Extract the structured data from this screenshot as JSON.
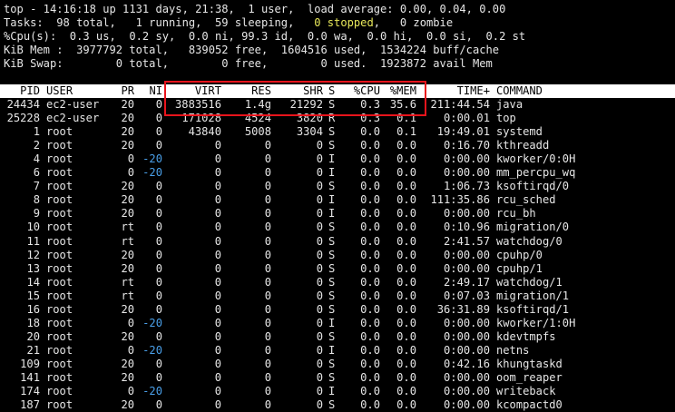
{
  "summary": {
    "line1": "top - 14:16:18 up 1131 days, 21:38,  1 user,  load average: 0.00, 0.04, 0.00",
    "tasks_pre": "Tasks:  98 total,   1 running,  59 sleeping,   ",
    "tasks_stopped": "0 stopped",
    "tasks_post": ",   0 zombie",
    "cpu": "%Cpu(s):  0.3 us,  0.2 sy,  0.0 ni, 99.3 id,  0.0 wa,  0.0 hi,  0.0 si,  0.2 st",
    "mem": "KiB Mem :  3977792 total,   839052 free,  1604516 used,  1534224 buff/cache",
    "swap": "KiB Swap:        0 total,        0 free,        0 used.  1923872 avail Mem"
  },
  "header": {
    "pid": "PID",
    "user": "USER",
    "pr": "PR",
    "ni": "NI",
    "virt": "VIRT",
    "res": "RES",
    "shr": "SHR",
    "s": "S",
    "cpu": "%CPU",
    "mem": "%MEM",
    "time": "TIME+",
    "command": "COMMAND"
  },
  "processes": [
    {
      "pid": "24434",
      "user": "ec2-user",
      "pr": "20",
      "ni": "0",
      "virt": "3883516",
      "res": "1.4g",
      "shr": "21292",
      "s": "S",
      "cpu": "0.3",
      "mem": "35.6",
      "time": "211:44.54",
      "command": "java"
    },
    {
      "pid": "25228",
      "user": "ec2-user",
      "pr": "20",
      "ni": "0",
      "virt": "171028",
      "res": "4524",
      "shr": "3820",
      "s": "R",
      "cpu": "0.3",
      "mem": "0.1",
      "time": "0:00.01",
      "command": "top"
    },
    {
      "pid": "1",
      "user": "root",
      "pr": "20",
      "ni": "0",
      "virt": "43840",
      "res": "5008",
      "shr": "3304",
      "s": "S",
      "cpu": "0.0",
      "mem": "0.1",
      "time": "19:49.01",
      "command": "systemd"
    },
    {
      "pid": "2",
      "user": "root",
      "pr": "20",
      "ni": "0",
      "virt": "0",
      "res": "0",
      "shr": "0",
      "s": "S",
      "cpu": "0.0",
      "mem": "0.0",
      "time": "0:16.70",
      "command": "kthreadd"
    },
    {
      "pid": "4",
      "user": "root",
      "pr": "0",
      "ni": "-20",
      "virt": "0",
      "res": "0",
      "shr": "0",
      "s": "I",
      "cpu": "0.0",
      "mem": "0.0",
      "time": "0:00.00",
      "command": "kworker/0:0H"
    },
    {
      "pid": "6",
      "user": "root",
      "pr": "0",
      "ni": "-20",
      "virt": "0",
      "res": "0",
      "shr": "0",
      "s": "I",
      "cpu": "0.0",
      "mem": "0.0",
      "time": "0:00.00",
      "command": "mm_percpu_wq"
    },
    {
      "pid": "7",
      "user": "root",
      "pr": "20",
      "ni": "0",
      "virt": "0",
      "res": "0",
      "shr": "0",
      "s": "S",
      "cpu": "0.0",
      "mem": "0.0",
      "time": "1:06.73",
      "command": "ksoftirqd/0"
    },
    {
      "pid": "8",
      "user": "root",
      "pr": "20",
      "ni": "0",
      "virt": "0",
      "res": "0",
      "shr": "0",
      "s": "I",
      "cpu": "0.0",
      "mem": "0.0",
      "time": "111:35.86",
      "command": "rcu_sched"
    },
    {
      "pid": "9",
      "user": "root",
      "pr": "20",
      "ni": "0",
      "virt": "0",
      "res": "0",
      "shr": "0",
      "s": "I",
      "cpu": "0.0",
      "mem": "0.0",
      "time": "0:00.00",
      "command": "rcu_bh"
    },
    {
      "pid": "10",
      "user": "root",
      "pr": "rt",
      "ni": "0",
      "virt": "0",
      "res": "0",
      "shr": "0",
      "s": "S",
      "cpu": "0.0",
      "mem": "0.0",
      "time": "0:10.96",
      "command": "migration/0"
    },
    {
      "pid": "11",
      "user": "root",
      "pr": "rt",
      "ni": "0",
      "virt": "0",
      "res": "0",
      "shr": "0",
      "s": "S",
      "cpu": "0.0",
      "mem": "0.0",
      "time": "2:41.57",
      "command": "watchdog/0"
    },
    {
      "pid": "12",
      "user": "root",
      "pr": "20",
      "ni": "0",
      "virt": "0",
      "res": "0",
      "shr": "0",
      "s": "S",
      "cpu": "0.0",
      "mem": "0.0",
      "time": "0:00.00",
      "command": "cpuhp/0"
    },
    {
      "pid": "13",
      "user": "root",
      "pr": "20",
      "ni": "0",
      "virt": "0",
      "res": "0",
      "shr": "0",
      "s": "S",
      "cpu": "0.0",
      "mem": "0.0",
      "time": "0:00.00",
      "command": "cpuhp/1"
    },
    {
      "pid": "14",
      "user": "root",
      "pr": "rt",
      "ni": "0",
      "virt": "0",
      "res": "0",
      "shr": "0",
      "s": "S",
      "cpu": "0.0",
      "mem": "0.0",
      "time": "2:49.17",
      "command": "watchdog/1"
    },
    {
      "pid": "15",
      "user": "root",
      "pr": "rt",
      "ni": "0",
      "virt": "0",
      "res": "0",
      "shr": "0",
      "s": "S",
      "cpu": "0.0",
      "mem": "0.0",
      "time": "0:07.03",
      "command": "migration/1"
    },
    {
      "pid": "16",
      "user": "root",
      "pr": "20",
      "ni": "0",
      "virt": "0",
      "res": "0",
      "shr": "0",
      "s": "S",
      "cpu": "0.0",
      "mem": "0.0",
      "time": "36:31.89",
      "command": "ksoftirqd/1"
    },
    {
      "pid": "18",
      "user": "root",
      "pr": "0",
      "ni": "-20",
      "virt": "0",
      "res": "0",
      "shr": "0",
      "s": "I",
      "cpu": "0.0",
      "mem": "0.0",
      "time": "0:00.00",
      "command": "kworker/1:0H"
    },
    {
      "pid": "20",
      "user": "root",
      "pr": "20",
      "ni": "0",
      "virt": "0",
      "res": "0",
      "shr": "0",
      "s": "S",
      "cpu": "0.0",
      "mem": "0.0",
      "time": "0:00.00",
      "command": "kdevtmpfs"
    },
    {
      "pid": "21",
      "user": "root",
      "pr": "0",
      "ni": "-20",
      "virt": "0",
      "res": "0",
      "shr": "0",
      "s": "I",
      "cpu": "0.0",
      "mem": "0.0",
      "time": "0:00.00",
      "command": "netns"
    },
    {
      "pid": "109",
      "user": "root",
      "pr": "20",
      "ni": "0",
      "virt": "0",
      "res": "0",
      "shr": "0",
      "s": "S",
      "cpu": "0.0",
      "mem": "0.0",
      "time": "0:42.16",
      "command": "khungtaskd"
    },
    {
      "pid": "141",
      "user": "root",
      "pr": "20",
      "ni": "0",
      "virt": "0",
      "res": "0",
      "shr": "0",
      "s": "S",
      "cpu": "0.0",
      "mem": "0.0",
      "time": "0:00.00",
      "command": "oom_reaper"
    },
    {
      "pid": "174",
      "user": "root",
      "pr": "0",
      "ni": "-20",
      "virt": "0",
      "res": "0",
      "shr": "0",
      "s": "I",
      "cpu": "0.0",
      "mem": "0.0",
      "time": "0:00.00",
      "command": "writeback"
    },
    {
      "pid": "187",
      "user": "root",
      "pr": "20",
      "ni": "0",
      "virt": "0",
      "res": "0",
      "shr": "0",
      "s": "S",
      "cpu": "0.0",
      "mem": "0.0",
      "time": "0:00.00",
      "command": "kcompactd0"
    }
  ],
  "colors": {
    "background": "#000000",
    "text": "#e6e6e6",
    "stopped": "#e8e85a",
    "negative_nice": "#4a9fe8",
    "header_bar": "#ffffff",
    "highlight_box": "#e8141c"
  }
}
